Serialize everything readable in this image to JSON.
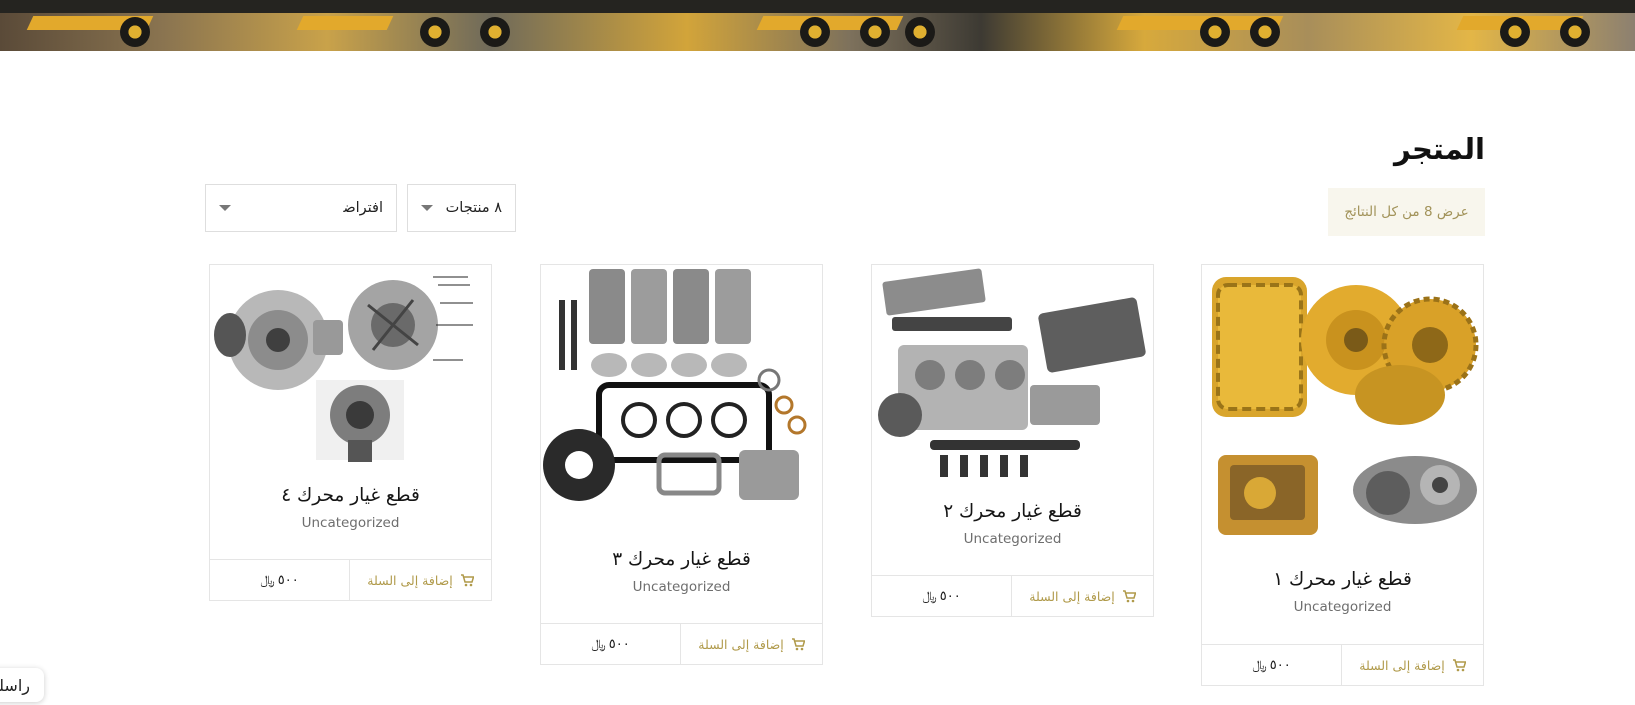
{
  "page": {
    "title": "المتجر",
    "result_count": "عرض 8 من كل النتائج"
  },
  "controls": {
    "per_page": "٨ منتجات",
    "sort": "افتراض‍"
  },
  "products": [
    {
      "name": "قطع غيار محرك ١",
      "category": "Uncategorized",
      "add_to_cart": "إضافة إلى السلة",
      "price": "٥٠٠",
      "currency": "﷼",
      "image": "undercarriage-and-engine-parts"
    },
    {
      "name": "قطع غيار محرك ٢",
      "category": "Uncategorized",
      "add_to_cart": "إضافة إلى السلة",
      "price": "٥٠٠",
      "currency": "﷼",
      "image": "engine-block-exploded"
    },
    {
      "name": "قطع غيار محرك ٣",
      "category": "Uncategorized",
      "add_to_cart": "إضافة إلى السلة",
      "price": "٥٠٠",
      "currency": "﷼",
      "image": "piston-liner-gasket-kit"
    },
    {
      "name": "قطع غيار محرك ٤",
      "category": "Uncategorized",
      "add_to_cart": "إضافة إلى السلة",
      "price": "٥٠٠",
      "currency": "﷼",
      "image": "turbocharger-parts"
    }
  ],
  "chat": {
    "label": "راسلنا"
  },
  "colors": {
    "accent": "#b09a4a",
    "result_bg": "#f8f6ed",
    "border": "#e5e5e5"
  }
}
